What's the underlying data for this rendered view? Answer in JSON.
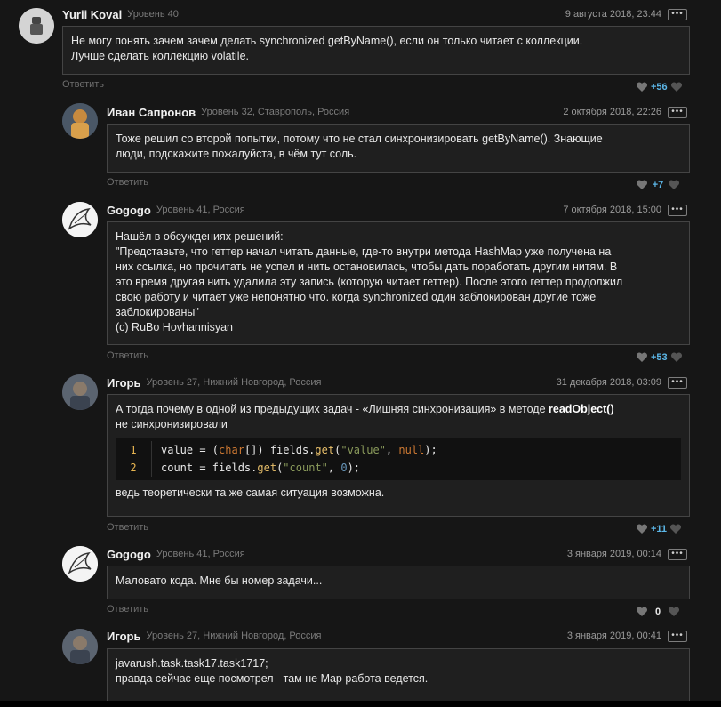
{
  "reply_label": "Ответить",
  "comments": [
    {
      "author": "Yurii Koval",
      "meta": "Уровень 40",
      "date": "9 августа 2018, 23:44",
      "lines": [
        "Не могу понять зачем зачем делать synchronized getByName(), если он только читает с коллекции.",
        "Лучше сделать коллекцию volatile."
      ],
      "votes": "+56"
    },
    {
      "author": "Иван Сапронов",
      "meta": "Уровень 32, Ставрополь, Россия",
      "date": "2 октября 2018, 22:26",
      "lines": [
        "Тоже решил со второй попытки, потому что не стал синхронизировать getByName(). Знающие",
        "люди, подскажите пожалуйста, в чём тут соль."
      ],
      "votes": "+7"
    },
    {
      "author": "Gogogo",
      "meta": "Уровень 41, Россия",
      "date": "7 октября 2018, 15:00",
      "lines": [
        "Нашёл в обсуждениях решений:",
        "\"Представьте, что геттер начал читать данные, где-то внутри метода HashMap уже получена на",
        "них ссылка, но прочитать не успел и нить остановилась, чтобы дать поработать другим нитям. В",
        "это время другая нить удалила эту запись (которую читает геттер). После этого геттер продолжил",
        "свою работу и читает уже непонятно что. когда  synchronized один заблокирован другие тоже",
        "заблокированы\"",
        "(с) RuBo Hovhannisyan"
      ],
      "votes": "+53"
    },
    {
      "author": "Игорь",
      "meta": "Уровень 27, Нижний Новгород, Россия",
      "date": "31 декабря 2018, 03:09",
      "intro_a": "А тогда почему в одной из предыдущих задач - «Лишняя синхронизация» в методе ",
      "intro_bold": "readObject()",
      "intro_b": "не синхронизировали",
      "code": {
        "line1_no": "1",
        "line2_no": "2",
        "l1_a": "value = (",
        "l1_kw": "char",
        "l1_b": "[]) fields.",
        "l1_fn": "get",
        "l1_c": "(",
        "l1_str": "\"value\"",
        "l1_d": ", ",
        "l1_kw2": "null",
        "l1_e": ");",
        "l2_a": "count = fields.",
        "l2_fn": "get",
        "l2_b": "(",
        "l2_str": "\"count\"",
        "l2_c": ", ",
        "l2_num": "0",
        "l2_d": ");"
      },
      "outro": "ведь теоретически та же самая ситуация возможна.",
      "votes": "+11"
    },
    {
      "author": "Gogogo",
      "meta": "Уровень 41, Россия",
      "date": "3 января 2019, 00:14",
      "lines": [
        "Маловато кода. Мне бы номер задачи..."
      ],
      "votes": "0"
    },
    {
      "author": "Игорь",
      "meta": "Уровень 27, Нижний Новгород, Россия",
      "date": "3 января 2019, 00:41",
      "lines": [
        "javarush.task.task17.task1717;",
        "правда сейчас еще посмотрел - там не Map работа ведется."
      ]
    }
  ]
}
